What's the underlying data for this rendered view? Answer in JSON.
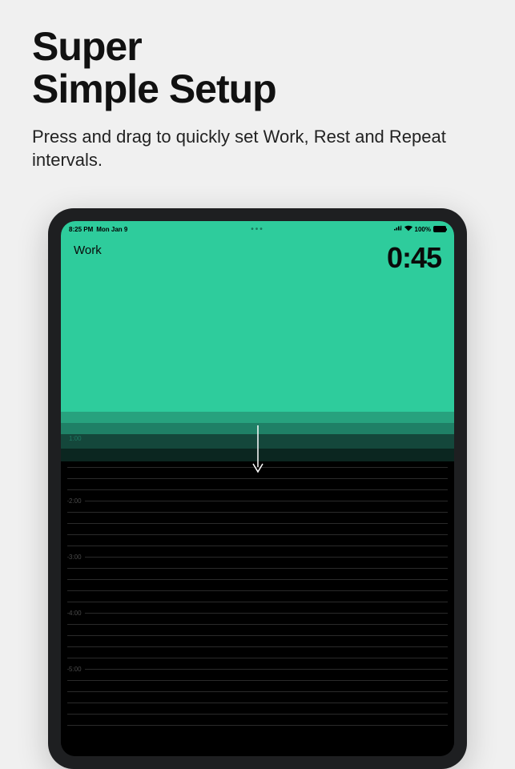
{
  "promo": {
    "title_line1": "Super",
    "title_line2": "Simple Setup",
    "subtitle": "Press and drag to quickly set Work, Rest and Repeat intervals."
  },
  "statusbar": {
    "time": "8:25 PM",
    "date": "Mon Jan 9",
    "battery_pct": "100%"
  },
  "timer": {
    "mode_label": "Work",
    "time": "0:45"
  },
  "ruler": {
    "tick_100": "1:00",
    "major_labels": [
      "2:00",
      "3:00",
      "4:00",
      "5:00"
    ]
  },
  "colors": {
    "accent": "#2ecc9c",
    "text_dark": "#0a0a0a"
  }
}
